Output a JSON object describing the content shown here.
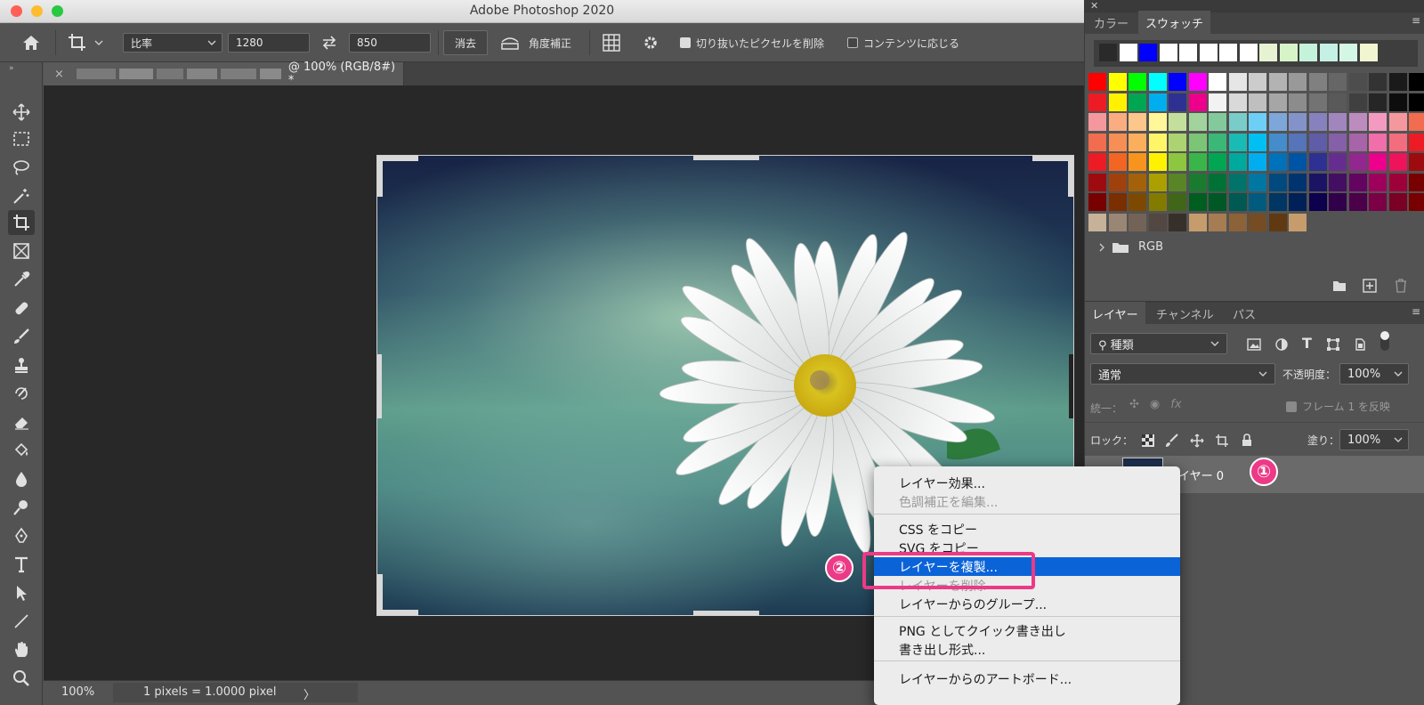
{
  "window": {
    "title": "Adobe Photoshop 2020"
  },
  "options": {
    "ratio_label": "比率",
    "width": "1280",
    "height": "850",
    "clear_label": "消去",
    "straighten_label": "角度補正",
    "delete_cropped_label": "切り抜いたピクセルを削除",
    "content_aware_label": "コンテンツに応じる"
  },
  "document": {
    "tab_title": "@ 100% (RGB/8#) *",
    "close": "×"
  },
  "status": {
    "zoom": "100%",
    "info": "1 pixels = 1.0000 pixel",
    "arrow": "〉"
  },
  "swatches_panel": {
    "tab_color": "カラー",
    "tab_swatches": "スウォッチ",
    "group_name": "RGB",
    "recent": [
      "#2a2a2a",
      "#ffffff",
      "#0000ff",
      "#ffffff",
      "#ffffff",
      "#ffffff",
      "#ffffff",
      "#ffffff",
      "#e6f2d2",
      "#d7f4c8",
      "#c5f2da",
      "#c5f0e4",
      "#d4f6e5",
      "#f2f6d0"
    ],
    "grid": [
      [
        "#ff0000",
        "#ffff00",
        "#00ff00",
        "#00ffff",
        "#0000ff",
        "#ff00ff",
        "#ffffff",
        "#e6e6e6",
        "#cccccc",
        "#b3b3b3",
        "#999999",
        "#808080",
        "#666666",
        "#4d4d4d",
        "#333333",
        "#1a1a1a",
        "#000000"
      ],
      [
        "#ed1c24",
        "#fff200",
        "#00a651",
        "#00aeef",
        "#2e3192",
        "#ec008c",
        "#f2f2f2",
        "#d9d9d9",
        "#bfbfbf",
        "#a6a6a6",
        "#8c8c8c",
        "#737373",
        "#595959",
        "#404040",
        "#262626",
        "#0d0d0d",
        "#000000"
      ],
      [
        "#f5989d",
        "#f9ad81",
        "#fdc68a",
        "#fff799",
        "#c4df9b",
        "#a3d39c",
        "#82ca9c",
        "#7accc8",
        "#6dcff6",
        "#7da7d9",
        "#8393ca",
        "#8781bd",
        "#a186be",
        "#bd8cbf",
        "#f49ac1",
        "#f5989d",
        "#f26c4f"
      ],
      [
        "#f26c4f",
        "#f68e56",
        "#fbaf5d",
        "#fff568",
        "#acd372",
        "#7cc576",
        "#3bb878",
        "#1abbb4",
        "#00bff3",
        "#448ccb",
        "#5574b9",
        "#605ca8",
        "#8560a8",
        "#a864a8",
        "#f06eaa",
        "#f26d7d",
        "#ed1c24"
      ],
      [
        "#ed1c24",
        "#f26522",
        "#f7941d",
        "#fff200",
        "#8dc63f",
        "#39b54a",
        "#00a651",
        "#00a99d",
        "#00aeef",
        "#0072bc",
        "#0054a6",
        "#2e3192",
        "#662d91",
        "#92278f",
        "#ec008c",
        "#ed145b",
        "#9e0b0f"
      ],
      [
        "#9e0b0f",
        "#a0410d",
        "#a36209",
        "#aba000",
        "#598527",
        "#1a7b30",
        "#007236",
        "#00746b",
        "#0076a3",
        "#004a80",
        "#003471",
        "#1b1464",
        "#440e62",
        "#630460",
        "#9e005d",
        "#9e0039",
        "#790000"
      ],
      [
        "#790000",
        "#7b2e00",
        "#7d4900",
        "#827b00",
        "#406618",
        "#005e20",
        "#005826",
        "#005952",
        "#005b7f",
        "#003663",
        "#002157",
        "#0d004c",
        "#32004b",
        "#4b0049",
        "#7b0046",
        "#7a0026",
        "#790000"
      ],
      [
        "#c7b299",
        "#998675",
        "#736357",
        "#534741",
        "#37302a",
        "#c69c6d",
        "#a67c52",
        "#8c6239",
        "#754c24",
        "#603913",
        "#c69c6d"
      ]
    ]
  },
  "layers_panel": {
    "tab_layers": "レイヤー",
    "tab_channels": "チャンネル",
    "tab_paths": "パス",
    "filter_label": "種類",
    "blend_mode": "通常",
    "opacity_label": "不透明度：",
    "opacity_value": "100%",
    "unify_label": "統一：",
    "propagate_label": "フレーム 1 を反映",
    "lock_label": "ロック：",
    "fill_label": "塗り：",
    "fill_value": "100%",
    "layer_name": "レイヤー 0"
  },
  "context_menu": {
    "items": [
      {
        "label": "レイヤー効果...",
        "disabled": false
      },
      {
        "label": "色調補正を編集...",
        "disabled": true
      },
      {
        "label": "CSS をコピー",
        "disabled": false
      },
      {
        "label": "SVG をコピー",
        "disabled": false
      },
      {
        "label": "レイヤーを複製...",
        "disabled": false,
        "selected": true
      },
      {
        "label": "レイヤーを削除",
        "disabled": true
      },
      {
        "label": "レイヤーからのグループ...",
        "disabled": false
      },
      {
        "label": "PNG としてクイック書き出し",
        "disabled": false
      },
      {
        "label": "書き出し形式...",
        "disabled": false
      },
      {
        "label": "レイヤーからのアートボード...",
        "disabled": false
      }
    ]
  },
  "annotations": {
    "step1": "①",
    "step2": "②",
    "highlight_color": "#ec3a86"
  }
}
